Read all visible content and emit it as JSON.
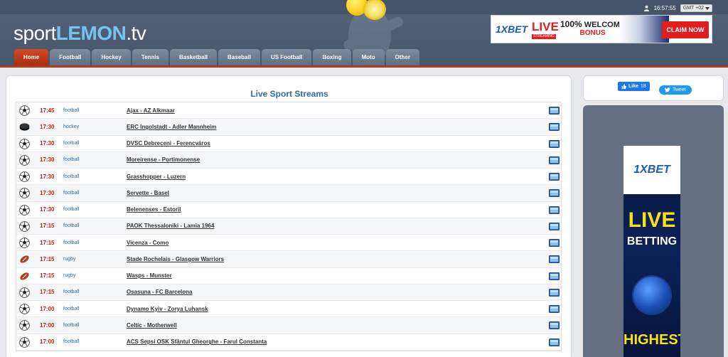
{
  "header": {
    "logo_prefix": "sport",
    "logo_brand": "LEMON",
    "logo_suffix": ".tv",
    "time": "16:57:55",
    "timezone": "GMT +02",
    "colors": {
      "accent": "#77c3f0",
      "nav_active": "#c0401c",
      "nav_line": "#b23a18"
    }
  },
  "banner": {
    "brand": "1XBET",
    "live": "LIVE",
    "streaming": "STREAMING",
    "welcome_pct": "100%",
    "welcome": "WELCOME",
    "bonus": "BONUS",
    "claim": "CLAIM NOW"
  },
  "nav": {
    "tabs": [
      {
        "label": "Home",
        "active": true
      },
      {
        "label": "Football"
      },
      {
        "label": "Hockey"
      },
      {
        "label": "Tennis"
      },
      {
        "label": "Basketball"
      },
      {
        "label": "Baseball"
      },
      {
        "label": "US Football"
      },
      {
        "label": "Boxing"
      },
      {
        "label": "Moto"
      },
      {
        "label": "Other"
      }
    ]
  },
  "main": {
    "title": "Live Sport Streams",
    "events": [
      {
        "time": "17:45",
        "sport": "football",
        "icon": "soccer-ball-icon",
        "match": "Ajax - AZ Alkmaar"
      },
      {
        "time": "17:30",
        "sport": "hockey",
        "icon": "hockey-puck-icon",
        "match": "ERC Ingolstadt - Adler Mannheim"
      },
      {
        "time": "17:30",
        "sport": "football",
        "icon": "soccer-ball-icon",
        "match": "DVSC Debreceni - Ferencváros"
      },
      {
        "time": "17:30",
        "sport": "football",
        "icon": "soccer-ball-icon",
        "match": "Moreirense - Portimonense"
      },
      {
        "time": "17:30",
        "sport": "football",
        "icon": "soccer-ball-icon",
        "match": "Grasshopper - Luzern"
      },
      {
        "time": "17:30",
        "sport": "football",
        "icon": "soccer-ball-icon",
        "match": "Servette - Basel"
      },
      {
        "time": "17:30",
        "sport": "football",
        "icon": "soccer-ball-icon",
        "match": "Belenenses - Estoril"
      },
      {
        "time": "17:15",
        "sport": "football",
        "icon": "soccer-ball-icon",
        "match": "PAOK Thessaloniki - Lamia 1964"
      },
      {
        "time": "17:15",
        "sport": "football",
        "icon": "soccer-ball-icon",
        "match": "Vicenza - Como"
      },
      {
        "time": "17:15",
        "sport": "rugby",
        "icon": "rugby-ball-icon",
        "match": "Stade Rochelais - Glasgow Warriors"
      },
      {
        "time": "17:15",
        "sport": "rugby",
        "icon": "rugby-ball-icon",
        "match": "Wasps - Munster"
      },
      {
        "time": "17:15",
        "sport": "football",
        "icon": "soccer-ball-icon",
        "match": "Osasuna - FC Barcelona"
      },
      {
        "time": "17:00",
        "sport": "football",
        "icon": "soccer-ball-icon",
        "match": "Dynamo Kyiv - Zorya Luhansk"
      },
      {
        "time": "17:00",
        "sport": "football",
        "icon": "soccer-ball-icon",
        "match": "Celtic - Motherwell"
      },
      {
        "time": "17:00",
        "sport": "football",
        "icon": "soccer-ball-icon",
        "match": "ACS Sepsi OSK Sfântul Gheorghe - Farul Constanta"
      }
    ]
  },
  "sidebar": {
    "like_label": "Like",
    "like_count": "18",
    "tweet_label": "Tweet",
    "ad": {
      "brand": "1XBET",
      "line1": "LIVE",
      "line2": "BETTING",
      "line3": "HIGHEST"
    }
  }
}
